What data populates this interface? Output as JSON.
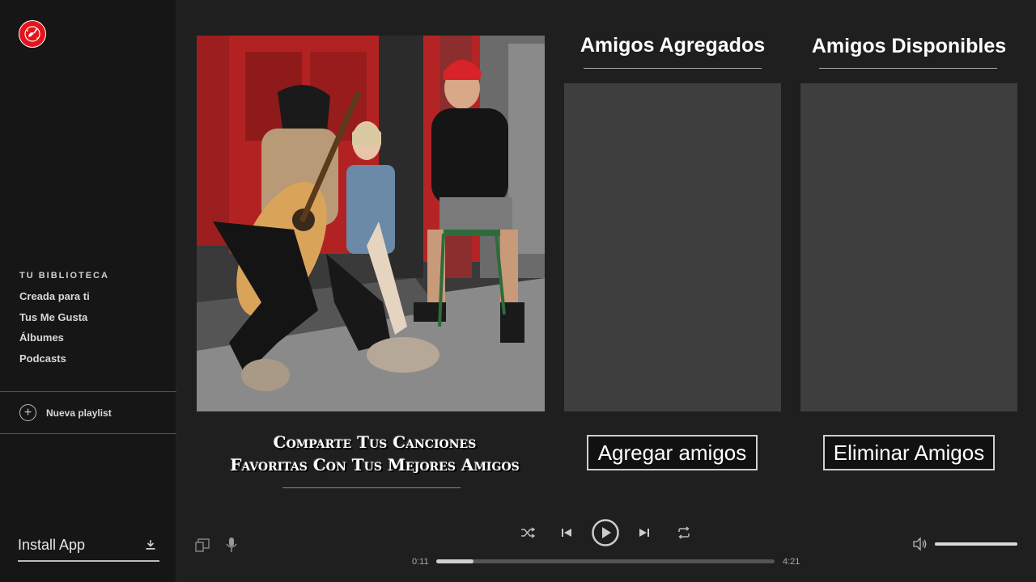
{
  "sidebar": {
    "library_title": "TU BIBLIOTECA",
    "items": [
      {
        "label": "Creada para ti"
      },
      {
        "label": "Tus Me Gusta"
      },
      {
        "label": "Álbumes"
      },
      {
        "label": "Podcasts"
      }
    ],
    "new_playlist": "Nueva playlist",
    "install_app": "Install App"
  },
  "main": {
    "tagline_line1": "Comparte Tus Canciones",
    "tagline_line2": "Favoritas Con Tus Mejores Amigos",
    "added_title": "Amigos Agregados",
    "available_title": "Amigos Disponibles",
    "add_button": "Agregar amigos",
    "remove_button": "Eliminar Amigos"
  },
  "player": {
    "elapsed": "0:11",
    "duration": "4:21",
    "progress_fraction": 0.11,
    "volume_fraction": 1.0
  },
  "colors": {
    "brand": "#e4141c",
    "background": "#1f1f1f",
    "sidebar": "#161616",
    "panel": "#3e3e3e"
  },
  "icons": [
    "logo-icon",
    "plus-circle-icon",
    "download-icon",
    "devices-icon",
    "microphone-icon",
    "shuffle-icon",
    "previous-icon",
    "play-icon",
    "next-icon",
    "repeat-icon",
    "volume-icon"
  ]
}
